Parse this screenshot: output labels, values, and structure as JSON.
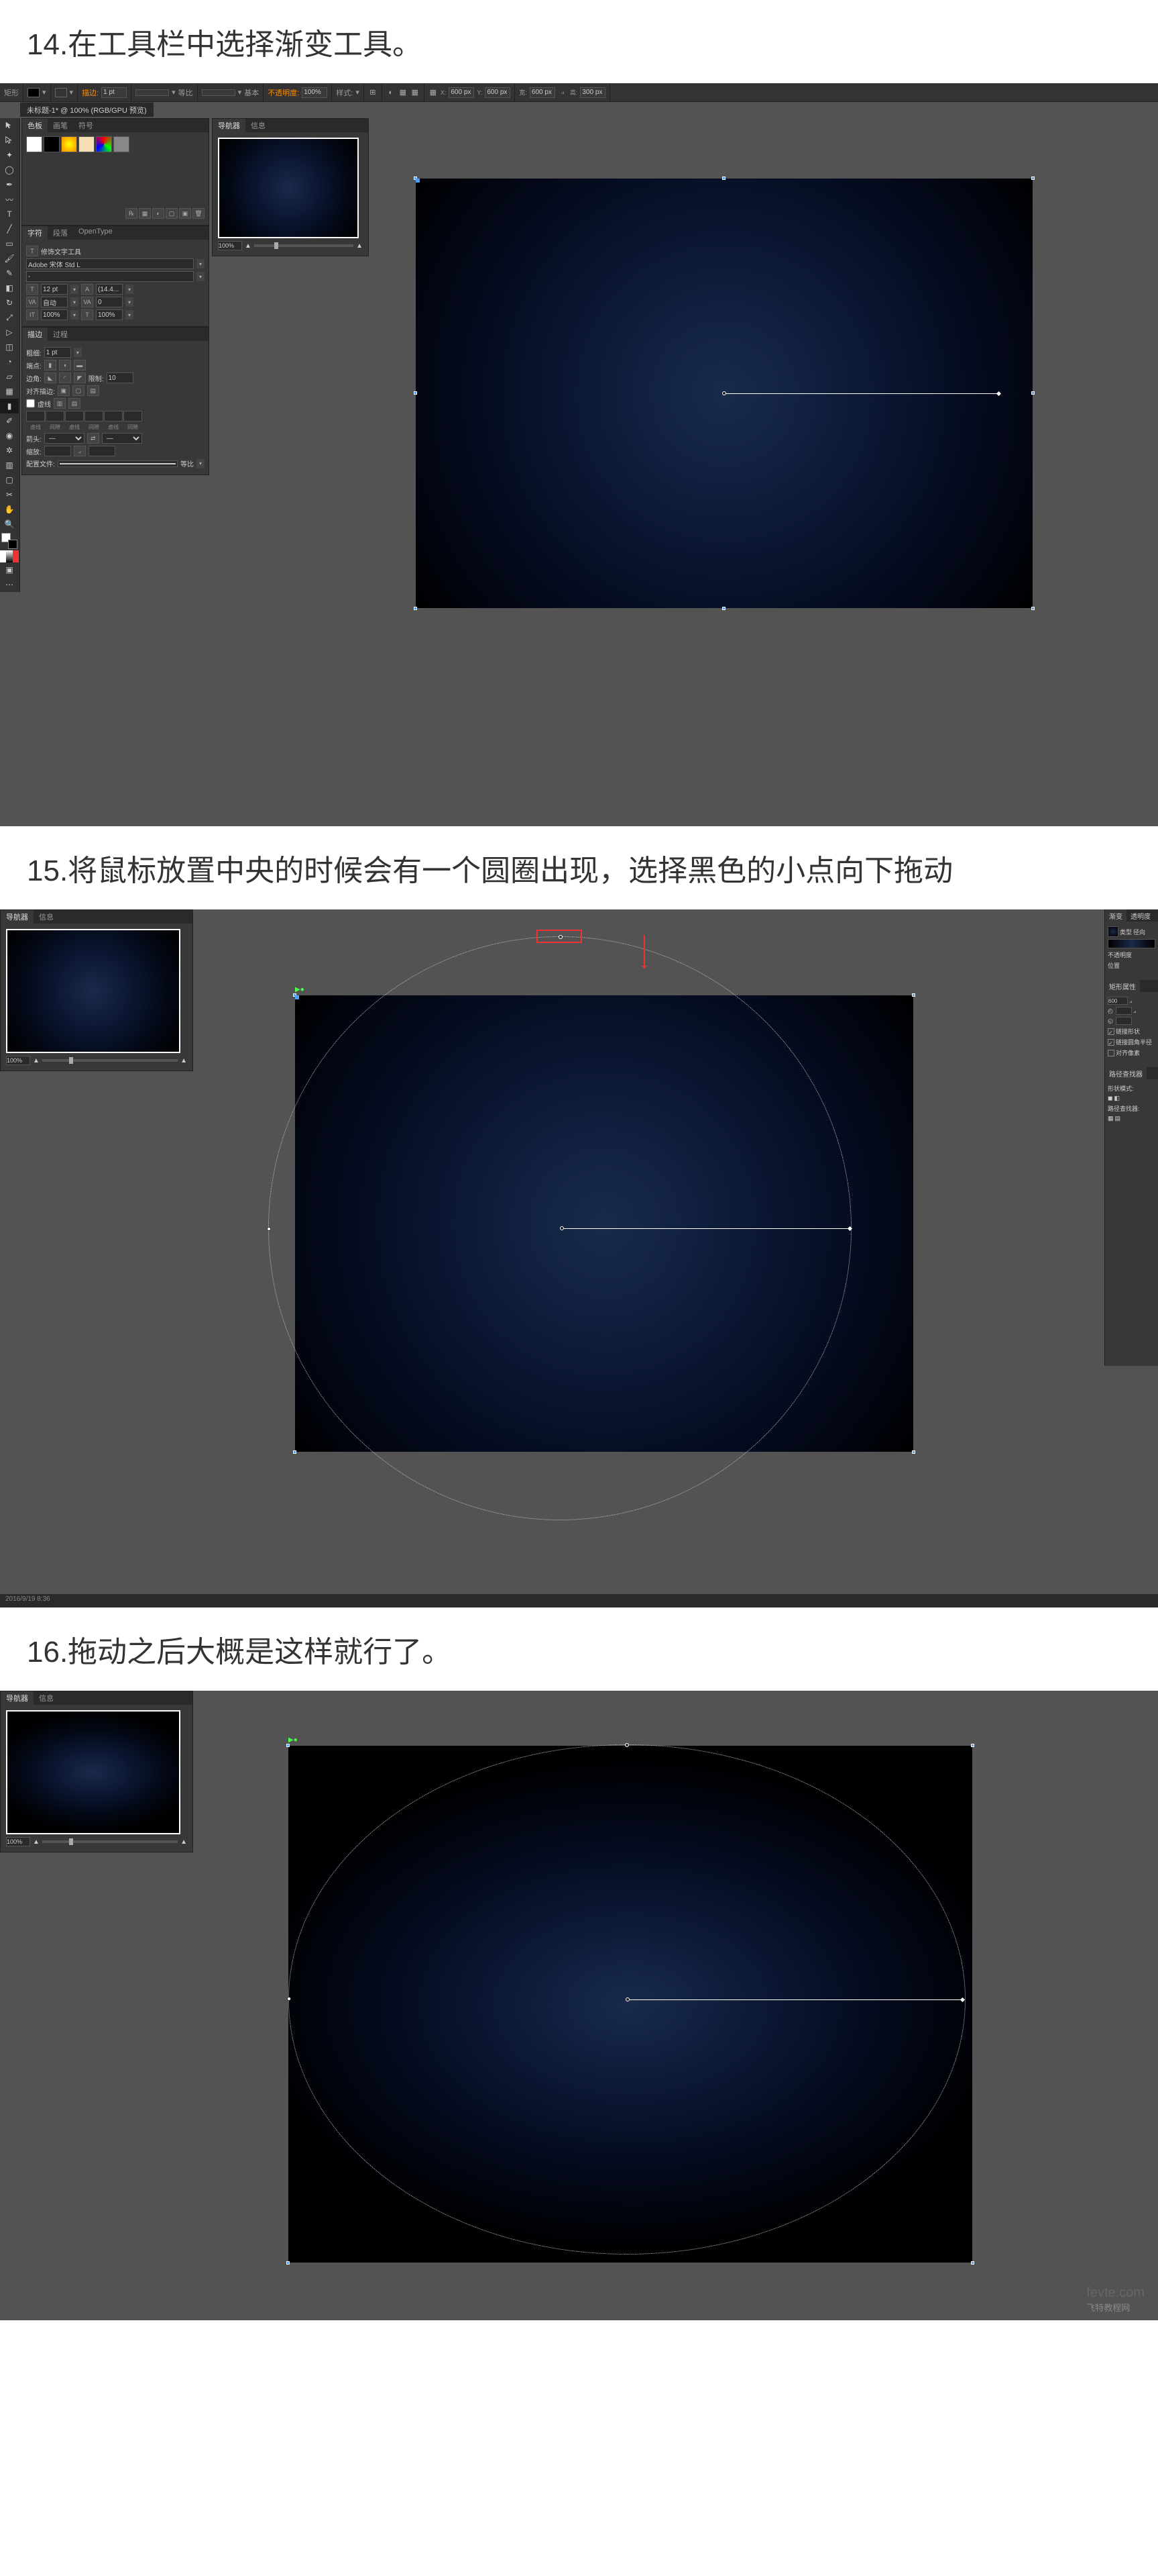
{
  "steps": {
    "s14": "14.在工具栏中选择渐变工具。",
    "s15": "15.将鼠标放置中央的时候会有一个圆圈出现，选择黑色的小点向下拖动",
    "s16": "16.拖动之后大概是这样就行了。"
  },
  "topbar": {
    "shape_label": "矩形",
    "stroke_label": "描边:",
    "stroke_val": "1 pt",
    "uniform": "等比",
    "basic": "基本",
    "opacity_label": "不透明度:",
    "opacity_val": "100%",
    "style_label": "样式:",
    "w_val": "600 px",
    "h_val": "300 px",
    "x_val": "600 px",
    "y_val": "600 px"
  },
  "doc_tab": "未标题-1* @ 100% (RGB/GPU 预览)",
  "panels": {
    "color_tabs": [
      "色板",
      "画笔",
      "符号"
    ],
    "nav_tabs": [
      "导航器",
      "信息"
    ],
    "char_tabs": [
      "字符",
      "段落",
      "OpenType"
    ],
    "touch_tool": "修饰文字工具",
    "font": "Adobe 宋体 Std L",
    "size": "12 pt",
    "leading": "(14.4...",
    "kerning": "自动",
    "tracking": "0",
    "vscale": "100%",
    "hscale": "100%",
    "stroke_tabs": [
      "描边",
      "过程"
    ],
    "weight": "粗细:",
    "weight_val": "1 pt",
    "cap": "端点:",
    "corner": "边角:",
    "limit": "限制:",
    "limit_val": "10",
    "align": "对齐描边:",
    "dash": "虚线",
    "gap_labels": [
      "虚线",
      "间隙",
      "虚线",
      "间隙",
      "虚线",
      "间隙"
    ],
    "arrow": "箭头:",
    "scale": "缩放:",
    "profile": "配置文件:",
    "uniform": "等比"
  },
  "nav": {
    "zoom": "100%"
  },
  "right": {
    "tabs": [
      "渐变",
      "透明度"
    ],
    "type": "类型",
    "radial": "径向",
    "opacity": "不透明度",
    "position": "位置",
    "props_title": "矩形属性",
    "link_text": "链接形状",
    "link_corner": "链接圆角半径",
    "align_text": "对齐像素",
    "pathfinder": "路径查找器",
    "shape_mode": "形状模式:",
    "pathfinder2": "路径查找器:"
  },
  "status": "2016/9/19  8:36",
  "watermark": {
    "main": "fevte.com",
    "sub": "飞特教程网"
  }
}
